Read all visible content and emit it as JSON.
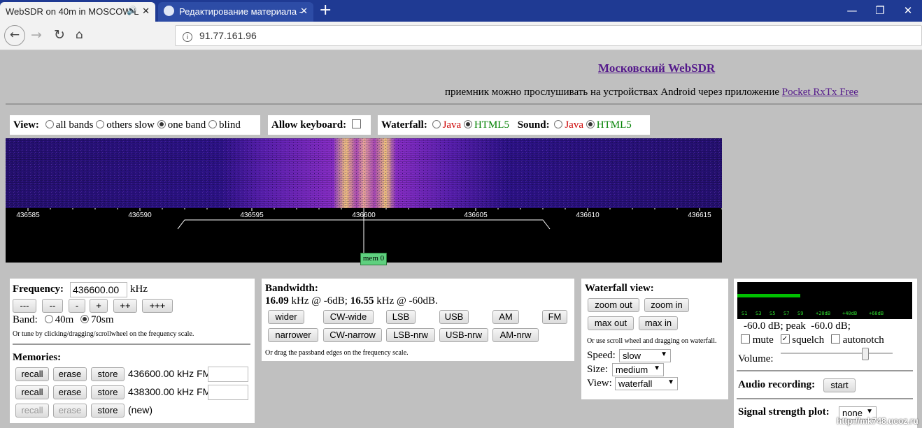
{
  "browser": {
    "tabs": [
      {
        "title": "WebSDR on 40m in MOSCOW L"
      },
      {
        "title": "Редактирование материала -"
      }
    ],
    "url": "91.77.161.96"
  },
  "header": {
    "title": "Московский WebSDR",
    "subtitle": "приемник можно прослушивать на устройствах Android через приложение",
    "app_link": "Pocket RxTx Free"
  },
  "view": {
    "label": "View:",
    "options": [
      "all bands",
      "others slow",
      "one band",
      "blind"
    ],
    "selected": "one band"
  },
  "keyboard": {
    "label": "Allow keyboard:"
  },
  "waterfall_mode": {
    "label": "Waterfall:",
    "options": [
      "Java",
      "HTML5"
    ],
    "selected": "HTML5"
  },
  "sound_mode": {
    "label": "Sound:",
    "options": [
      "Java",
      "HTML5"
    ],
    "selected": "HTML5"
  },
  "scale": {
    "ticks": [
      "436585",
      "436590",
      "436595",
      "436600",
      "436605",
      "436610",
      "436615"
    ],
    "marker": "mem 0"
  },
  "frequency": {
    "label": "Frequency:",
    "value": "436600.00",
    "unit": "kHz",
    "step_buttons": [
      "---",
      "--",
      "-",
      "+",
      "++",
      "+++"
    ],
    "band_label": "Band:",
    "bands": [
      "40m",
      "70sm"
    ],
    "selected_band": "70sm",
    "hint": "Or tune by clicking/dragging/scrollwheel on the frequency scale."
  },
  "memories": {
    "label": "Memories:",
    "rows": [
      {
        "recall": "recall",
        "erase": "erase",
        "store": "store",
        "text": "436600.00 kHz FM"
      },
      {
        "recall": "recall",
        "erase": "erase",
        "store": "store",
        "text": "438300.00 kHz FM"
      },
      {
        "recall": "recall",
        "erase": "erase",
        "store": "store",
        "text": "(new)"
      }
    ]
  },
  "bandwidth": {
    "label": "Bandwidth:",
    "v1": "16.09",
    "t1": " kHz @ -6dB; ",
    "v2": "16.55",
    "t2": " kHz @ -60dB.",
    "row1": [
      "wider",
      "CW-wide",
      "LSB",
      "USB",
      "AM",
      "FM"
    ],
    "row2": [
      "narrower",
      "CW-narrow",
      "LSB-nrw",
      "USB-nrw",
      "AM-nrw"
    ],
    "hint": "Or drag the passband edges on the frequency scale."
  },
  "waterfall_view": {
    "label": "Waterfall view:",
    "zoom_out": "zoom out",
    "zoom_in": "zoom in",
    "max_out": "max out",
    "max_in": "max in",
    "hint": "Or use scroll wheel and dragging on waterfall.",
    "speed_label": "Speed:",
    "speed": "slow",
    "size_label": "Size:",
    "size": "medium",
    "view_label": "View:",
    "view": "waterfall"
  },
  "smeter": {
    "scale": [
      "S1",
      "S3",
      "S5",
      "S7",
      "S9",
      "+20dB",
      "+40dB",
      "+60dB"
    ],
    "level": 0.36,
    "reading": "-60.0 dB; peak  -60.0 dB;",
    "mute": "mute",
    "squelch": "squelch",
    "autonotch": "autonotch",
    "squelch_checked": true,
    "volume_label": "Volume:",
    "volume_level": 0.75
  },
  "audio_recording": {
    "label": "Audio recording:",
    "start": "start"
  },
  "signal_plot": {
    "label": "Signal strength plot:",
    "value": "none"
  },
  "watermark": "http://mk748.ucoz.ru",
  "colors": {
    "accent": "#551a8b",
    "java_red": "#cc0000",
    "html5_green": "#008000",
    "meter_green": "#00c000"
  }
}
